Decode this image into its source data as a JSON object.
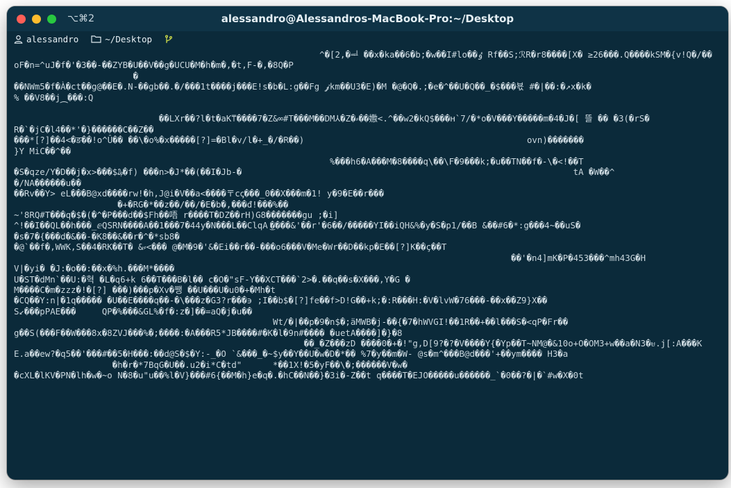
{
  "window": {
    "shortcut": "⌥⌘2",
    "title": "alessandro@Alessandros-MacBook-Pro:~/Desktop"
  },
  "infobar": {
    "user": "alessandro",
    "path": "~/Desktop"
  },
  "terminal": {
    "lines": [
      "                                                           ^�[2,�ᆗ ��x�ka��6�b;�w��I#lo��ٶ Rf��S;ℛR�r8����[X� ≥26���.Q����kSM�{v!Q�/��",
      "oF�n=^uJ�f�'�3��-��ZYB�U��V��g�UCU�M�h�m�,�t,F-�,�8Q�P",
      "                       �",
      "��NWm5�f�À�ct��g@��E�.N-��gb��.�/���1t����j���E!s�b�L:g��Fg 𝓳km��U3�E)�M �@�Q�.;�e�^��U�Q��_�$���뵧 #�|��:�↗x�k�",
      "% ��V8��j⁔���:Q",
      "",
      "                            ��LXr��?l�t�aK⍑����7�Z&∞#T���M��DM⅄�Z�⸗��嫐<.^��w2�kQ$���ʜ`7/�*o�V���Y�����m�4�J�[ 뜰 �� �3(�rS�",
      "R�`�jC�l4��*'�}������C��Z��",
      "���*[?]��4<�ङ��!o^Û�� ��\\�o%�x�����[?]=�Bl�v/l�+_�/�R��)                                           ovn)�������",
      "}Y MiC��^��",
      "                                                             %���h6�A���M�8����q\\��\\F�9���k;�u��TN��f�-\\�<!��T",
      "�S�qze/Y�D��j�x>���$₯�f) ���n>�J*��(��I�Jb-�                                                                tA �W��^",
      "�/NA������u��",
      "��Rv��Y> eL���B@xd����rw!�h,J@i�V��a<����〒cꞔ���_0��X���m�1! y�9�E��r���",
      "                    �+�RG�*��z��/��/�E�b�,���đ!���%��",
      "~'8RQ#T���q�$�(�^�P���d��$Fh��唔 r����T�DZ��rH)G8�������gu ;�i]",
      "^!��I��QL��h���_ⅇQSRN����A��1���7�44y�N���L��ClqA ͜����&'��r'�6��/�����YI��iQH&%�y�S�p1/��B &��#6�*:g���4~��uS�",
      "�s�7�{���d�&��-�K8��&��r�^�*sb8�",
      "�@`��f�,WWK,S��4�RK��T� &⸗<��� @�M�9�'&�Ei��r��-���o6���V�Me�Wr��D��kp�E��[?]K��ç��T",
      "                                                                                                ��'�n4]mK�P�453���^mh43G�H",
      "V|�yi� �J:�o��:��x�%h.���M*����",
      "U�ST�dMn`��U:�혁 �L�q6+k 6��T���B�l�� c�O�\"sF-Y��XCT���`2>�.��q��s�X���,Y�G �",
      "M����C�m�zzz�!�[?] ���)���p�Xv�쨍 ��U���U�u0�+�Mh�t",
      "�CQ��Y:n|�1q����� �U��E����q��-�\\���z�G3?r���϶ ;I��b$�[?]fe��f>D!G��+k;�:R���H:�V�lvW�76���-��x��Z9}X��",
      "S↙���pPAE���     QP�%���&GL%�f�:z�]��=aQ�j�u��",
      "                                                  Wt/�|��p�9�n$�;äMWB�j-��{�7�hWVGI!��1R��+��l���S�<qP�Fr��",
      "g��S(���F��W���8x�8ZVJ���%�;����:�A���R5*JB����#�K�l�9n#���� �uetA����]�}�8",
      "                                                        ��_�Z���zD ����0�+�!\"g,D[9?�?�V����Y{�Yp��T~NM@�&10o+O�OM3+w��a�N3�ᵾ.j[:A���K",
      "E.a��ew?�q5��'���#��5�H���:��d@S�$�Y:-_�O `&���_�~$y��Y��U�w�D�*�� %7�y��m�W- @s�m^���B@d���'+��ym���� H3�a",
      "                   �h�r�*7BqG�U��.u2�i*C�td\"      *��1X!�5�yF��\\�;������V�w�",
      "�cXL�lKV�PN�lh�w�~o N�8�u\"u��%l�V}���#6{��M�h}e�q�.�hC��N��}�3i�-Z��t q����T�EJO�����u������_`�0��?�|�`#w�X�0t"
    ]
  }
}
